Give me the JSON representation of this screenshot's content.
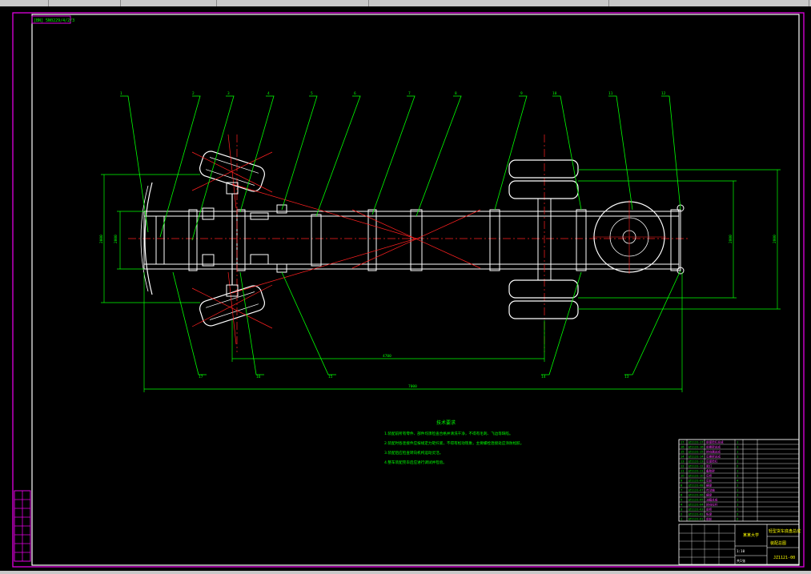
{
  "sheet_code": "[BN] 5N0229/4/2/3",
  "balloons": [
    "1",
    "2",
    "3",
    "4",
    "5",
    "6",
    "7",
    "8",
    "9",
    "10",
    "11",
    "12"
  ],
  "balloons_bottom": [
    "17",
    "16",
    "15",
    "14",
    "13"
  ],
  "dims": {
    "wheelbase": "4700",
    "overall_length": "7000",
    "frame_width": "2000",
    "front_track": "2000",
    "rear_track": "2800",
    "overall_width": "2800"
  },
  "notes": {
    "title": "技术要求",
    "items": [
      "1.装配前所有零件、部件均须检查合格并清洗干净，不得有毛刺、飞边等缺陷。",
      "2.装配时各连接件应按规定力矩拧紧，不得有松动现象，主要螺栓连接处应涂防松胶。",
      "3.装配后应检查转向机构运动灵活。",
      "4.整车装配完毕后应进行调试并检验。"
    ]
  },
  "bom_rows": [
    [
      "17",
      "JZ1121-17",
      "前保险杠总成",
      "1",
      ""
    ],
    [
      "16",
      "JZ1121-16",
      "前悬架总成",
      "1",
      ""
    ],
    [
      "15",
      "JZ1121-15",
      "转向器总成",
      "1",
      ""
    ],
    [
      "14",
      "JZ1121-14",
      "后悬架总成",
      "1",
      ""
    ],
    [
      "13",
      "JZ1121-13",
      "后保险杠",
      "1",
      ""
    ],
    [
      "12",
      "JZ1121-12",
      "尾灯",
      "2",
      ""
    ],
    [
      "11",
      "JZ1121-11",
      "备胎架",
      "1",
      ""
    ],
    [
      "10",
      "JZ1121-10",
      "后桥",
      "1",
      ""
    ],
    [
      "9",
      "JZ1121-09",
      "后轮",
      "4",
      ""
    ],
    [
      "8",
      "JZ1121-08",
      "横梁",
      "1",
      ""
    ],
    [
      "7",
      "JZ1121-07",
      "传动轴",
      "1",
      ""
    ],
    [
      "6",
      "JZ1121-06",
      "横梁",
      "1",
      ""
    ],
    [
      "5",
      "JZ1121-05",
      "油箱总成",
      "1",
      ""
    ],
    [
      "4",
      "JZ1121-04",
      "转向拉杆",
      "1",
      ""
    ],
    [
      "3",
      "JZ1121-03",
      "前桥",
      "1",
      ""
    ],
    [
      "2",
      "JZ1121-02",
      "纵梁",
      "2",
      ""
    ],
    [
      "1",
      "JZ1121-01",
      "前轮",
      "2",
      ""
    ]
  ],
  "title_block": {
    "school": "某某大学",
    "title": "轻型货车底盘总成",
    "subtitle": "装配总图",
    "drawing_no": "JZ1121-00",
    "scale": "1:10",
    "sheet": "共1张"
  },
  "left_sidebar_rows": 8
}
